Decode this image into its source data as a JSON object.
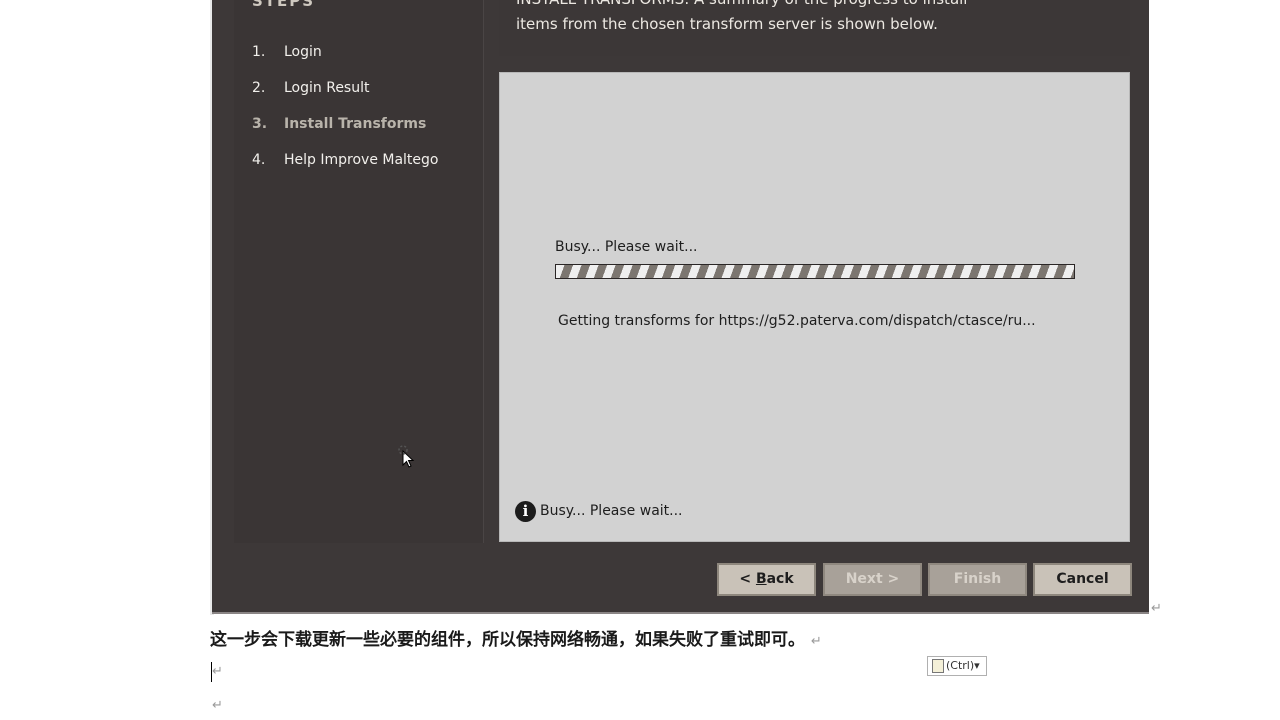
{
  "wizard": {
    "steps_title": "STEPS",
    "steps": [
      {
        "num": "1.",
        "label": "Login"
      },
      {
        "num": "2.",
        "label": "Login Result"
      },
      {
        "num": "3.",
        "label": "Install Transforms"
      },
      {
        "num": "4.",
        "label": "Help Improve Maltego"
      }
    ],
    "description_line1": "INSTALL TRANSFORMS: A summary of the progress to install",
    "description_line2": "items from the chosen transform server is shown below.",
    "busy_label": "Busy... Please wait...",
    "progress_indeterminate": true,
    "transform_text": "Getting transforms for https://g52.paterva.com/dispatch/ctasce/ru...",
    "status_text": "Busy... Please wait...",
    "status_icon": "info-icon",
    "buttons": {
      "back_prefix": "< ",
      "back_mnemonic": "B",
      "back_rest": "ack",
      "next": "Next >",
      "finish": "Finish",
      "cancel": "Cancel"
    }
  },
  "document": {
    "paragraph": "这一步会下载更新一些必要的组件，所以保持网络畅通，如果失败了重试即可。",
    "para_mark": "↵",
    "paste_options": "(Ctrl)▾"
  },
  "colors": {
    "window_bg": "#3d3838",
    "content_bg": "#d2d2d2",
    "button_bg": "#c9c2b8"
  }
}
